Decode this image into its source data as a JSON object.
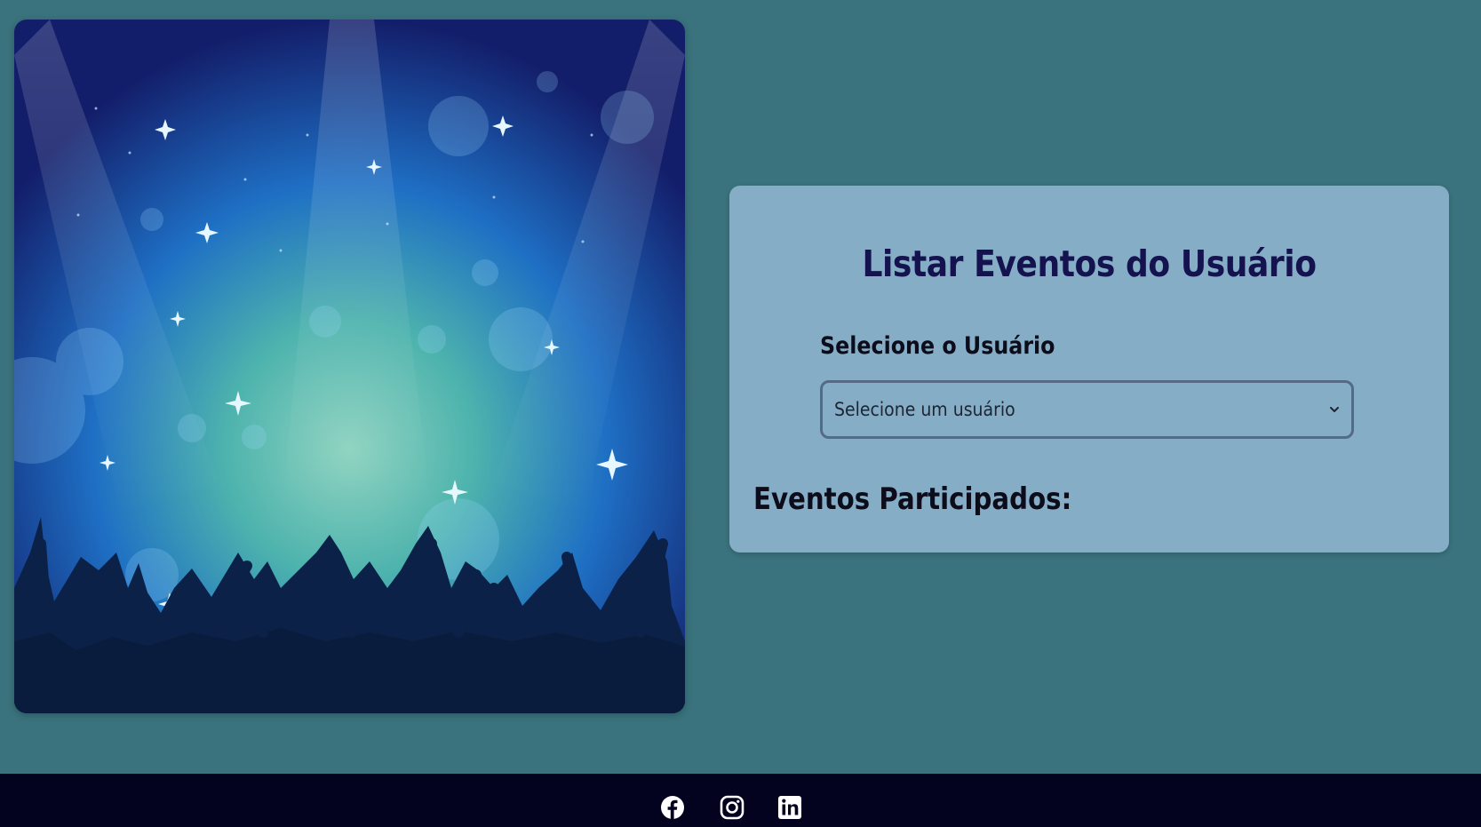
{
  "main": {
    "card": {
      "title": "Listar Eventos do Usuário",
      "user_select_label": "Selecione o Usuário",
      "user_select_value": "Selecione um usuário",
      "events_heading": "Eventos Participados:"
    },
    "hero_image": {
      "alt": "concert crowd silhouette under blue stage lights"
    }
  },
  "footer": {
    "social_icons": [
      "facebook-icon",
      "instagram-icon",
      "linkedin-icon"
    ]
  },
  "colors": {
    "page_background": "#3a737d",
    "card_background": "#86adc6",
    "title": "#14124f",
    "footer_background": "#03031f"
  }
}
